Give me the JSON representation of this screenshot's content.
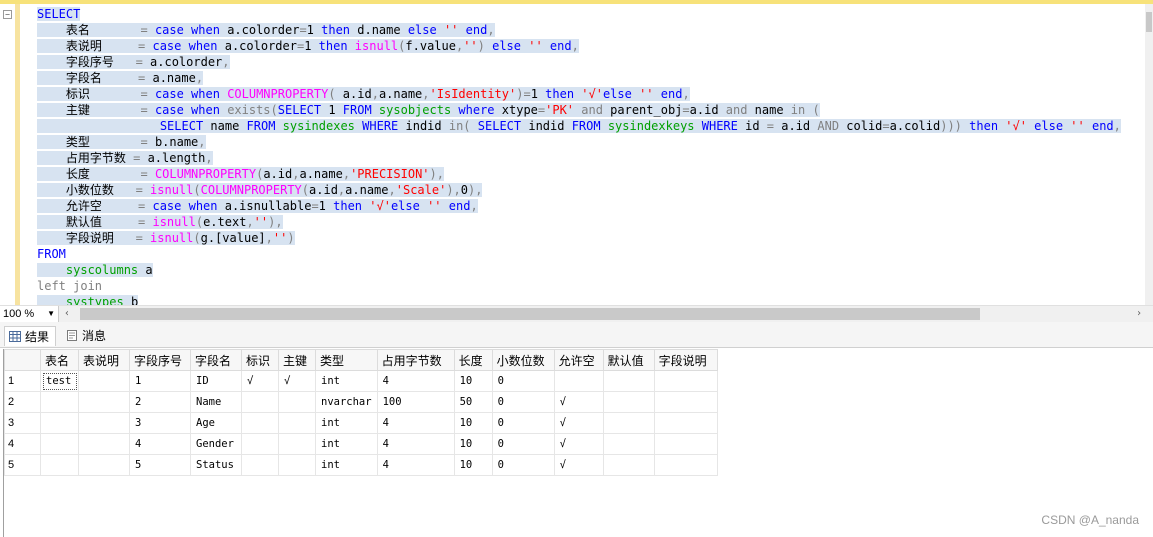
{
  "sql_lines": [
    {
      "sel": true,
      "tokens": [
        [
          "kw",
          "SELECT"
        ]
      ]
    },
    {
      "sel": true,
      "tokens": [
        [
          "t",
          "    表名       "
        ],
        [
          "op",
          "= "
        ],
        [
          "kw",
          "case when "
        ],
        [
          "t",
          "a.colorder"
        ],
        [
          "op",
          "="
        ],
        [
          "t",
          "1 "
        ],
        [
          "kw",
          "then "
        ],
        [
          "t",
          "d.name "
        ],
        [
          "kw",
          "else "
        ],
        [
          "str",
          "'' "
        ],
        [
          "kw",
          "end"
        ],
        [
          "op",
          ","
        ]
      ]
    },
    {
      "sel": true,
      "tokens": [
        [
          "t",
          "    表说明     "
        ],
        [
          "op",
          "= "
        ],
        [
          "kw",
          "case when "
        ],
        [
          "t",
          "a.colorder"
        ],
        [
          "op",
          "="
        ],
        [
          "t",
          "1 "
        ],
        [
          "kw",
          "then "
        ],
        [
          "fn",
          "isnull"
        ],
        [
          "op",
          "("
        ],
        [
          "t",
          "f.value"
        ],
        [
          "op",
          ","
        ],
        [
          "str",
          "''"
        ],
        [
          "op",
          ") "
        ],
        [
          "kw",
          "else "
        ],
        [
          "str",
          "'' "
        ],
        [
          "kw",
          "end"
        ],
        [
          "op",
          ","
        ]
      ]
    },
    {
      "sel": true,
      "tokens": [
        [
          "t",
          "    字段序号   "
        ],
        [
          "op",
          "= "
        ],
        [
          "t",
          "a.colorder"
        ],
        [
          "op",
          ","
        ]
      ]
    },
    {
      "sel": true,
      "tokens": [
        [
          "t",
          "    字段名     "
        ],
        [
          "op",
          "= "
        ],
        [
          "t",
          "a.name"
        ],
        [
          "op",
          ","
        ]
      ]
    },
    {
      "sel": true,
      "tokens": [
        [
          "t",
          "    标识       "
        ],
        [
          "op",
          "= "
        ],
        [
          "kw",
          "case when "
        ],
        [
          "fn",
          "COLUMNPROPERTY"
        ],
        [
          "op",
          "( "
        ],
        [
          "t",
          "a.id"
        ],
        [
          "op",
          ","
        ],
        [
          "t",
          "a.name"
        ],
        [
          "op",
          ","
        ],
        [
          "str",
          "'IsIdentity'"
        ],
        [
          "op",
          ")="
        ],
        [
          "t",
          "1 "
        ],
        [
          "kw",
          "then "
        ],
        [
          "str",
          "'√'"
        ],
        [
          "kw",
          "else "
        ],
        [
          "str",
          "'' "
        ],
        [
          "kw",
          "end"
        ],
        [
          "op",
          ","
        ]
      ]
    },
    {
      "sel": true,
      "tokens": [
        [
          "t",
          "    主键       "
        ],
        [
          "op",
          "= "
        ],
        [
          "kw",
          "case when "
        ],
        [
          "op",
          "exists("
        ],
        [
          "kw",
          "SELECT "
        ],
        [
          "t",
          "1 "
        ],
        [
          "kw",
          "FROM "
        ],
        [
          "sys",
          "sysobjects "
        ],
        [
          "kw",
          "where "
        ],
        [
          "t",
          "xtype"
        ],
        [
          "op",
          "="
        ],
        [
          "str",
          "'PK' "
        ],
        [
          "op",
          "and "
        ],
        [
          "t",
          "parent_obj"
        ],
        [
          "op",
          "="
        ],
        [
          "t",
          "a.id "
        ],
        [
          "op",
          "and "
        ],
        [
          "t",
          "name "
        ],
        [
          "op",
          "in ("
        ]
      ]
    },
    {
      "sel": true,
      "tokens": [
        [
          "t",
          "                 "
        ],
        [
          "kw",
          "SELECT "
        ],
        [
          "t",
          "name "
        ],
        [
          "kw",
          "FROM "
        ],
        [
          "sys",
          "sysindexes "
        ],
        [
          "kw",
          "WHERE "
        ],
        [
          "t",
          "indid "
        ],
        [
          "op",
          "in( "
        ],
        [
          "kw",
          "SELECT "
        ],
        [
          "t",
          "indid "
        ],
        [
          "kw",
          "FROM "
        ],
        [
          "sys",
          "sysindexkeys "
        ],
        [
          "kw",
          "WHERE "
        ],
        [
          "t",
          "id "
        ],
        [
          "op",
          "= "
        ],
        [
          "t",
          "a.id "
        ],
        [
          "op",
          "AND "
        ],
        [
          "t",
          "colid"
        ],
        [
          "op",
          "="
        ],
        [
          "t",
          "a.colid"
        ],
        [
          "op",
          ")))"
        ],
        [
          "t",
          " "
        ],
        [
          "kw",
          "then "
        ],
        [
          "str",
          "'√' "
        ],
        [
          "kw",
          "else "
        ],
        [
          "str",
          "'' "
        ],
        [
          "kw",
          "end"
        ],
        [
          "op",
          ","
        ]
      ]
    },
    {
      "sel": true,
      "tokens": [
        [
          "t",
          "    类型       "
        ],
        [
          "op",
          "= "
        ],
        [
          "t",
          "b.name"
        ],
        [
          "op",
          ","
        ]
      ]
    },
    {
      "sel": true,
      "tokens": [
        [
          "t",
          "    占用字节数 "
        ],
        [
          "op",
          "= "
        ],
        [
          "t",
          "a.length"
        ],
        [
          "op",
          ","
        ]
      ]
    },
    {
      "sel": true,
      "tokens": [
        [
          "t",
          "    长度       "
        ],
        [
          "op",
          "= "
        ],
        [
          "fn",
          "COLUMNPROPERTY"
        ],
        [
          "op",
          "("
        ],
        [
          "t",
          "a.id"
        ],
        [
          "op",
          ","
        ],
        [
          "t",
          "a.name"
        ],
        [
          "op",
          ","
        ],
        [
          "str",
          "'PRECISION'"
        ],
        [
          "op",
          "),"
        ]
      ]
    },
    {
      "sel": true,
      "tokens": [
        [
          "t",
          "    小数位数   "
        ],
        [
          "op",
          "= "
        ],
        [
          "fn",
          "isnull"
        ],
        [
          "op",
          "("
        ],
        [
          "fn",
          "COLUMNPROPERTY"
        ],
        [
          "op",
          "("
        ],
        [
          "t",
          "a.id"
        ],
        [
          "op",
          ","
        ],
        [
          "t",
          "a.name"
        ],
        [
          "op",
          ","
        ],
        [
          "str",
          "'Scale'"
        ],
        [
          "op",
          "),"
        ],
        [
          "t",
          "0"
        ],
        [
          "op",
          "),"
        ]
      ]
    },
    {
      "sel": true,
      "tokens": [
        [
          "t",
          "    允许空     "
        ],
        [
          "op",
          "= "
        ],
        [
          "kw",
          "case when "
        ],
        [
          "t",
          "a.isnullable"
        ],
        [
          "op",
          "="
        ],
        [
          "t",
          "1 "
        ],
        [
          "kw",
          "then "
        ],
        [
          "str",
          "'√'"
        ],
        [
          "kw",
          "else "
        ],
        [
          "str",
          "'' "
        ],
        [
          "kw",
          "end"
        ],
        [
          "op",
          ","
        ]
      ]
    },
    {
      "sel": true,
      "tokens": [
        [
          "t",
          "    默认值     "
        ],
        [
          "op",
          "= "
        ],
        [
          "fn",
          "isnull"
        ],
        [
          "op",
          "("
        ],
        [
          "t",
          "e.text"
        ],
        [
          "op",
          ","
        ],
        [
          "str",
          "''"
        ],
        [
          "op",
          "),"
        ]
      ]
    },
    {
      "sel": true,
      "tokens": [
        [
          "t",
          "    字段说明   "
        ],
        [
          "op",
          "= "
        ],
        [
          "fn",
          "isnull"
        ],
        [
          "op",
          "("
        ],
        [
          "t",
          "g.[value]"
        ],
        [
          "op",
          ","
        ],
        [
          "str",
          "''"
        ],
        [
          "op",
          ")"
        ]
      ]
    },
    {
      "sel": false,
      "tokens": [
        [
          "kw",
          "FROM"
        ]
      ]
    },
    {
      "sel": true,
      "tokens": [
        [
          "t",
          "    "
        ],
        [
          "sys",
          "syscolumns "
        ],
        [
          "t",
          "a"
        ]
      ]
    },
    {
      "sel": false,
      "tokens": [
        [
          "op",
          "left join"
        ]
      ]
    },
    {
      "sel": true,
      "tokens": [
        [
          "t",
          "    "
        ],
        [
          "sys",
          "systypes "
        ],
        [
          "t",
          "b"
        ]
      ]
    }
  ],
  "zoom": "100 %",
  "tabs": [
    {
      "label": "结果",
      "active": true
    },
    {
      "label": "消息",
      "active": false
    }
  ],
  "result": {
    "columns": [
      "表名",
      "表说明",
      "字段序号",
      "字段名",
      "标识",
      "主键",
      "类型",
      "占用字节数",
      "长度",
      "小数位数",
      "允许空",
      "默认值",
      "字段说明"
    ],
    "rows": [
      [
        "1",
        "test",
        "",
        "1",
        "ID",
        "√",
        "√",
        "int",
        "4",
        "10",
        "0",
        "",
        "",
        ""
      ],
      [
        "2",
        "",
        "",
        "2",
        "Name",
        "",
        "",
        "nvarchar",
        "100",
        "50",
        "0",
        "√",
        "",
        ""
      ],
      [
        "3",
        "",
        "",
        "3",
        "Age",
        "",
        "",
        "int",
        "4",
        "10",
        "0",
        "√",
        "",
        ""
      ],
      [
        "4",
        "",
        "",
        "4",
        "Gender",
        "",
        "",
        "int",
        "4",
        "10",
        "0",
        "√",
        "",
        ""
      ],
      [
        "5",
        "",
        "",
        "5",
        "Status",
        "",
        "",
        "int",
        "4",
        "10",
        "0",
        "√",
        "",
        ""
      ]
    ]
  },
  "watermark": "CSDN @A_nanda",
  "colors": {
    "keyword": "#0000ff",
    "function": "#ff00ff",
    "string": "#ff0000",
    "operator": "#808080",
    "sysobject": "#00a000",
    "selection": "#d7e3f1"
  }
}
